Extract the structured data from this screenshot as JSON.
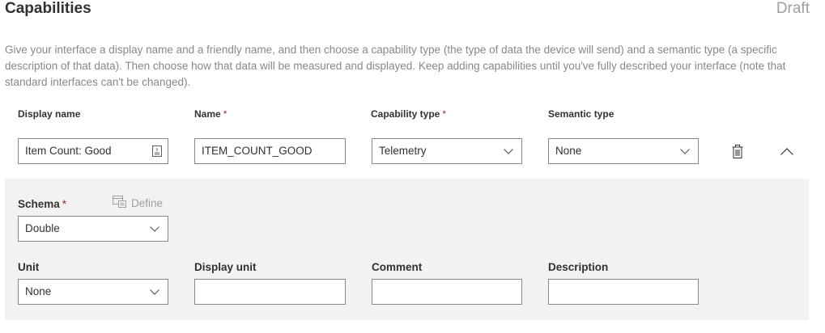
{
  "header": {
    "title": "Capabilities",
    "status": "Draft"
  },
  "description": "Give your interface a display name and a friendly name, and then choose a capability type (the type of data the device will send) and a semantic type (a specific description of that data). Then choose how that data will be measured and displayed. Keep adding capabilities until you've fully described your interface (note that standard interfaces can't be changed).",
  "columns": {
    "display_name": "Display name",
    "name": "Name",
    "capability_type": "Capability type",
    "semantic_type": "Semantic type",
    "required_mark": "*"
  },
  "capability": {
    "display_name_value": "Item Count: Good",
    "name_value": "ITEM_COUNT_GOOD",
    "capability_type_value": "Telemetry",
    "semantic_type_value": "None"
  },
  "details": {
    "schema_label": "Schema",
    "define_label": "Define",
    "schema_value": "Double",
    "unit_label": "Unit",
    "unit_value": "None",
    "display_unit_label": "Display unit",
    "display_unit_value": "",
    "comment_label": "Comment",
    "comment_value": "",
    "description_label": "Description",
    "description_value": ""
  },
  "icons": {
    "localize": "localize-icon",
    "delete": "trash-icon",
    "collapse": "chevron-up-icon",
    "dropdown": "chevron-down-icon",
    "define": "define-schema-icon"
  },
  "colors": {
    "required": "#a4262c",
    "muted": "#a19f9d",
    "panel": "#f3f2f1",
    "border": "#8a8886"
  }
}
